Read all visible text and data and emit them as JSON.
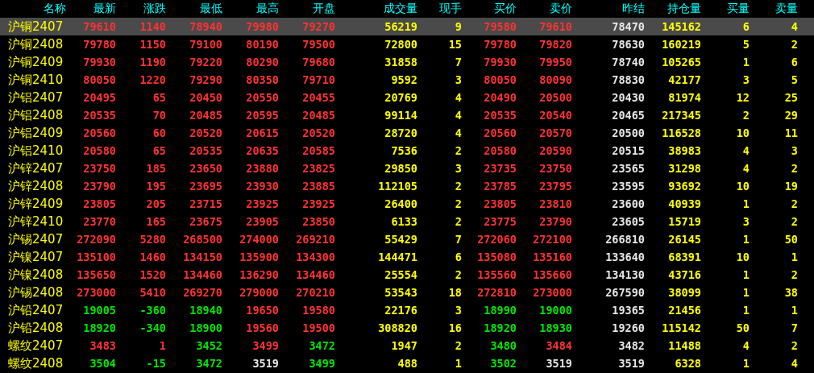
{
  "columns": [
    {
      "label": "名称",
      "kind": "name"
    },
    {
      "label": "最新",
      "kind": "price"
    },
    {
      "label": "涨跌",
      "kind": "price"
    },
    {
      "label": "最低",
      "kind": "price"
    },
    {
      "label": "最高",
      "kind": "price"
    },
    {
      "label": "开盘",
      "kind": "price"
    },
    {
      "label": "成交量",
      "kind": "volume"
    },
    {
      "label": "现手",
      "kind": "volume"
    },
    {
      "label": "买价",
      "kind": "price"
    },
    {
      "label": "卖价",
      "kind": "price"
    },
    {
      "label": "昨结",
      "kind": "plain"
    },
    {
      "label": "持仓量",
      "kind": "volume"
    },
    {
      "label": "买量",
      "kind": "volume"
    },
    {
      "label": "卖量",
      "kind": "volume"
    }
  ],
  "rows": [
    {
      "selected": true,
      "cells": [
        "沪铜2407",
        {
          "text": "79610",
          "color": "#ff3232"
        },
        {
          "text": "1140",
          "color": "#ff3232"
        },
        {
          "text": "78940",
          "color": "#ff3232"
        },
        {
          "text": "79980",
          "color": "#ff3232"
        },
        {
          "text": "79270",
          "color": "#ff3232"
        },
        "56219",
        "9",
        {
          "text": "79580",
          "color": "#ff3232"
        },
        {
          "text": "79610",
          "color": "#ff3232"
        },
        "78470",
        "145162",
        "6",
        "4"
      ]
    },
    {
      "selected": false,
      "cells": [
        "沪铜2408",
        {
          "text": "79780",
          "color": "#ff3232"
        },
        {
          "text": "1150",
          "color": "#ff3232"
        },
        {
          "text": "79100",
          "color": "#ff3232"
        },
        {
          "text": "80190",
          "color": "#ff3232"
        },
        {
          "text": "79500",
          "color": "#ff3232"
        },
        "72800",
        "15",
        {
          "text": "79780",
          "color": "#ff3232"
        },
        {
          "text": "79820",
          "color": "#ff3232"
        },
        "78630",
        "160219",
        "5",
        "2"
      ]
    },
    {
      "selected": false,
      "cells": [
        "沪铜2409",
        {
          "text": "79930",
          "color": "#ff3232"
        },
        {
          "text": "1190",
          "color": "#ff3232"
        },
        {
          "text": "79220",
          "color": "#ff3232"
        },
        {
          "text": "80290",
          "color": "#ff3232"
        },
        {
          "text": "79680",
          "color": "#ff3232"
        },
        "31858",
        "7",
        {
          "text": "79930",
          "color": "#ff3232"
        },
        {
          "text": "79950",
          "color": "#ff3232"
        },
        "78740",
        "105265",
        "1",
        "6"
      ]
    },
    {
      "selected": false,
      "cells": [
        "沪铜2410",
        {
          "text": "80050",
          "color": "#ff3232"
        },
        {
          "text": "1220",
          "color": "#ff3232"
        },
        {
          "text": "79290",
          "color": "#ff3232"
        },
        {
          "text": "80350",
          "color": "#ff3232"
        },
        {
          "text": "79710",
          "color": "#ff3232"
        },
        "9592",
        "3",
        {
          "text": "80050",
          "color": "#ff3232"
        },
        {
          "text": "80090",
          "color": "#ff3232"
        },
        "78830",
        "42177",
        "3",
        "5"
      ]
    },
    {
      "selected": false,
      "cells": [
        "沪铝2407",
        {
          "text": "20495",
          "color": "#ff3232"
        },
        {
          "text": "65",
          "color": "#ff3232"
        },
        {
          "text": "20450",
          "color": "#ff3232"
        },
        {
          "text": "20550",
          "color": "#ff3232"
        },
        {
          "text": "20455",
          "color": "#ff3232"
        },
        "20769",
        "4",
        {
          "text": "20490",
          "color": "#ff3232"
        },
        {
          "text": "20500",
          "color": "#ff3232"
        },
        "20430",
        "81974",
        "12",
        "25"
      ]
    },
    {
      "selected": false,
      "cells": [
        "沪铝2408",
        {
          "text": "20535",
          "color": "#ff3232"
        },
        {
          "text": "70",
          "color": "#ff3232"
        },
        {
          "text": "20485",
          "color": "#ff3232"
        },
        {
          "text": "20595",
          "color": "#ff3232"
        },
        {
          "text": "20485",
          "color": "#ff3232"
        },
        "99114",
        "4",
        {
          "text": "20535",
          "color": "#ff3232"
        },
        {
          "text": "20540",
          "color": "#ff3232"
        },
        "20465",
        "217345",
        "2",
        "29"
      ]
    },
    {
      "selected": false,
      "cells": [
        "沪铝2409",
        {
          "text": "20560",
          "color": "#ff3232"
        },
        {
          "text": "60",
          "color": "#ff3232"
        },
        {
          "text": "20520",
          "color": "#ff3232"
        },
        {
          "text": "20615",
          "color": "#ff3232"
        },
        {
          "text": "20520",
          "color": "#ff3232"
        },
        "28720",
        "4",
        {
          "text": "20560",
          "color": "#ff3232"
        },
        {
          "text": "20570",
          "color": "#ff3232"
        },
        "20500",
        "116528",
        "10",
        "11"
      ]
    },
    {
      "selected": false,
      "cells": [
        "沪铝2410",
        {
          "text": "20580",
          "color": "#ff3232"
        },
        {
          "text": "65",
          "color": "#ff3232"
        },
        {
          "text": "20535",
          "color": "#ff3232"
        },
        {
          "text": "20635",
          "color": "#ff3232"
        },
        {
          "text": "20585",
          "color": "#ff3232"
        },
        "7536",
        "2",
        {
          "text": "20580",
          "color": "#ff3232"
        },
        {
          "text": "20590",
          "color": "#ff3232"
        },
        "20515",
        "38983",
        "4",
        "3"
      ]
    },
    {
      "selected": false,
      "cells": [
        "沪锌2407",
        {
          "text": "23750",
          "color": "#ff3232"
        },
        {
          "text": "185",
          "color": "#ff3232"
        },
        {
          "text": "23650",
          "color": "#ff3232"
        },
        {
          "text": "23880",
          "color": "#ff3232"
        },
        {
          "text": "23825",
          "color": "#ff3232"
        },
        "29850",
        "3",
        {
          "text": "23735",
          "color": "#ff3232"
        },
        {
          "text": "23750",
          "color": "#ff3232"
        },
        "23565",
        "31298",
        "4",
        "2"
      ]
    },
    {
      "selected": false,
      "cells": [
        "沪锌2408",
        {
          "text": "23790",
          "color": "#ff3232"
        },
        {
          "text": "195",
          "color": "#ff3232"
        },
        {
          "text": "23695",
          "color": "#ff3232"
        },
        {
          "text": "23930",
          "color": "#ff3232"
        },
        {
          "text": "23885",
          "color": "#ff3232"
        },
        "112105",
        "2",
        {
          "text": "23785",
          "color": "#ff3232"
        },
        {
          "text": "23795",
          "color": "#ff3232"
        },
        "23595",
        "93692",
        "10",
        "19"
      ]
    },
    {
      "selected": false,
      "cells": [
        "沪锌2409",
        {
          "text": "23805",
          "color": "#ff3232"
        },
        {
          "text": "205",
          "color": "#ff3232"
        },
        {
          "text": "23715",
          "color": "#ff3232"
        },
        {
          "text": "23925",
          "color": "#ff3232"
        },
        {
          "text": "23925",
          "color": "#ff3232"
        },
        "26400",
        "2",
        {
          "text": "23805",
          "color": "#ff3232"
        },
        {
          "text": "23810",
          "color": "#ff3232"
        },
        "23600",
        "40939",
        "1",
        "2"
      ]
    },
    {
      "selected": false,
      "cells": [
        "沪锌2410",
        {
          "text": "23770",
          "color": "#ff3232"
        },
        {
          "text": "165",
          "color": "#ff3232"
        },
        {
          "text": "23675",
          "color": "#ff3232"
        },
        {
          "text": "23905",
          "color": "#ff3232"
        },
        {
          "text": "23850",
          "color": "#ff3232"
        },
        "6133",
        "2",
        {
          "text": "23775",
          "color": "#ff3232"
        },
        {
          "text": "23790",
          "color": "#ff3232"
        },
        "23605",
        "15719",
        "3",
        "2"
      ]
    },
    {
      "selected": false,
      "cells": [
        "沪锡2407",
        {
          "text": "272090",
          "color": "#ff3232"
        },
        {
          "text": "5280",
          "color": "#ff3232"
        },
        {
          "text": "268500",
          "color": "#ff3232"
        },
        {
          "text": "274000",
          "color": "#ff3232"
        },
        {
          "text": "269210",
          "color": "#ff3232"
        },
        "55429",
        "7",
        {
          "text": "272060",
          "color": "#ff3232"
        },
        {
          "text": "272100",
          "color": "#ff3232"
        },
        "266810",
        "26145",
        "1",
        "50"
      ]
    },
    {
      "selected": false,
      "cells": [
        "沪镍2407",
        {
          "text": "135100",
          "color": "#ff3232"
        },
        {
          "text": "1460",
          "color": "#ff3232"
        },
        {
          "text": "134150",
          "color": "#ff3232"
        },
        {
          "text": "135900",
          "color": "#ff3232"
        },
        {
          "text": "134300",
          "color": "#ff3232"
        },
        "144471",
        "6",
        {
          "text": "135080",
          "color": "#ff3232"
        },
        {
          "text": "135160",
          "color": "#ff3232"
        },
        "133640",
        "68391",
        "10",
        "1"
      ]
    },
    {
      "selected": false,
      "cells": [
        "沪镍2408",
        {
          "text": "135650",
          "color": "#ff3232"
        },
        {
          "text": "1520",
          "color": "#ff3232"
        },
        {
          "text": "134460",
          "color": "#ff3232"
        },
        {
          "text": "136290",
          "color": "#ff3232"
        },
        {
          "text": "134460",
          "color": "#ff3232"
        },
        "25554",
        "2",
        {
          "text": "135560",
          "color": "#ff3232"
        },
        {
          "text": "135660",
          "color": "#ff3232"
        },
        "134130",
        "43716",
        "1",
        "2"
      ]
    },
    {
      "selected": false,
      "cells": [
        "沪锡2408",
        {
          "text": "273000",
          "color": "#ff3232"
        },
        {
          "text": "5410",
          "color": "#ff3232"
        },
        {
          "text": "269270",
          "color": "#ff3232"
        },
        {
          "text": "279000",
          "color": "#ff3232"
        },
        {
          "text": "270210",
          "color": "#ff3232"
        },
        "53543",
        "18",
        {
          "text": "272810",
          "color": "#ff3232"
        },
        {
          "text": "273000",
          "color": "#ff3232"
        },
        "267590",
        "38099",
        "1",
        "38"
      ]
    },
    {
      "selected": false,
      "cells": [
        "沪铅2407",
        {
          "text": "19005",
          "color": "#00e600"
        },
        {
          "text": "-360",
          "color": "#00e600"
        },
        {
          "text": "18940",
          "color": "#00e600"
        },
        {
          "text": "19650",
          "color": "#ff3232"
        },
        {
          "text": "19580",
          "color": "#ff3232"
        },
        "22176",
        "3",
        {
          "text": "18990",
          "color": "#00e600"
        },
        {
          "text": "19000",
          "color": "#00e600"
        },
        "19365",
        "21456",
        "1",
        "1"
      ]
    },
    {
      "selected": false,
      "cells": [
        "沪铅2408",
        {
          "text": "18920",
          "color": "#00e600"
        },
        {
          "text": "-340",
          "color": "#00e600"
        },
        {
          "text": "18900",
          "color": "#00e600"
        },
        {
          "text": "19560",
          "color": "#ff3232"
        },
        {
          "text": "19500",
          "color": "#ff3232"
        },
        "308820",
        "16",
        {
          "text": "18920",
          "color": "#00e600"
        },
        {
          "text": "18930",
          "color": "#00e600"
        },
        "19260",
        "115142",
        "50",
        "7"
      ]
    },
    {
      "selected": false,
      "cells": [
        "螺纹2407",
        {
          "text": "3483",
          "color": "#ff3232"
        },
        {
          "text": "1",
          "color": "#ff3232"
        },
        {
          "text": "3452",
          "color": "#00e600"
        },
        {
          "text": "3499",
          "color": "#ff3232"
        },
        {
          "text": "3472",
          "color": "#00e600"
        },
        "1947",
        "2",
        {
          "text": "3480",
          "color": "#00e600"
        },
        {
          "text": "3484",
          "color": "#ff3232"
        },
        "3482",
        "11488",
        "4",
        "2"
      ]
    },
    {
      "selected": false,
      "cells": [
        "螺纹2408",
        {
          "text": "3504",
          "color": "#00e600"
        },
        {
          "text": "-15",
          "color": "#00e600"
        },
        {
          "text": "3472",
          "color": "#00e600"
        },
        {
          "text": "3519",
          "color": "#e6e6e6"
        },
        {
          "text": "3499",
          "color": "#00e600"
        },
        "488",
        "1",
        {
          "text": "3502",
          "color": "#00e600"
        },
        {
          "text": "3519",
          "color": "#e6e6e6"
        },
        "3519",
        "6328",
        "1",
        "4"
      ]
    }
  ]
}
